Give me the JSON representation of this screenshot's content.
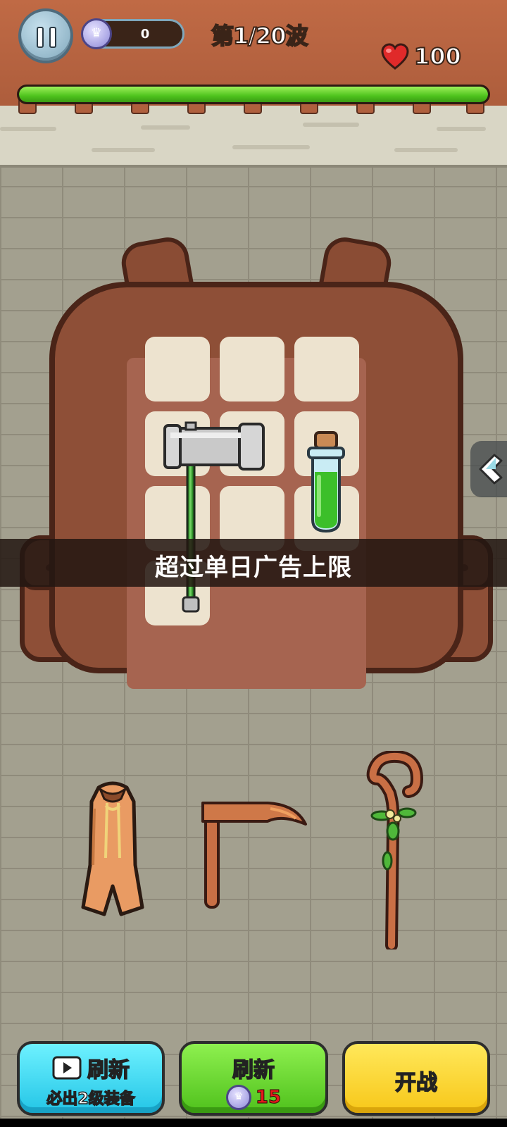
{
  "hud": {
    "gem_count": "0",
    "wave_label": "第1/20波",
    "health_value": "100",
    "wave_progress": 1.0
  },
  "backpack": {
    "items": [
      {
        "name": "hammer",
        "icon": "war-hammer-icon"
      },
      {
        "name": "potion",
        "icon": "green-potion-icon"
      }
    ]
  },
  "toast": {
    "message": "超过单日广告上限"
  },
  "shop": {
    "items": [
      {
        "icon": "cloak-icon"
      },
      {
        "icon": "scythe-icon"
      },
      {
        "icon": "staff-icon"
      }
    ]
  },
  "buttons": {
    "refresh_ad_label": "刷新",
    "refresh_ad_sub": "必出2级装备",
    "refresh_gem_label": "刷新",
    "refresh_gem_cost": "15",
    "battle_label": "开战"
  },
  "colors": {
    "header": "#c06a45",
    "progress_green": "#4ec31d",
    "refresh_ad": "#23c5e6",
    "refresh_gem": "#4fc11c",
    "battle": "#f7c719"
  }
}
